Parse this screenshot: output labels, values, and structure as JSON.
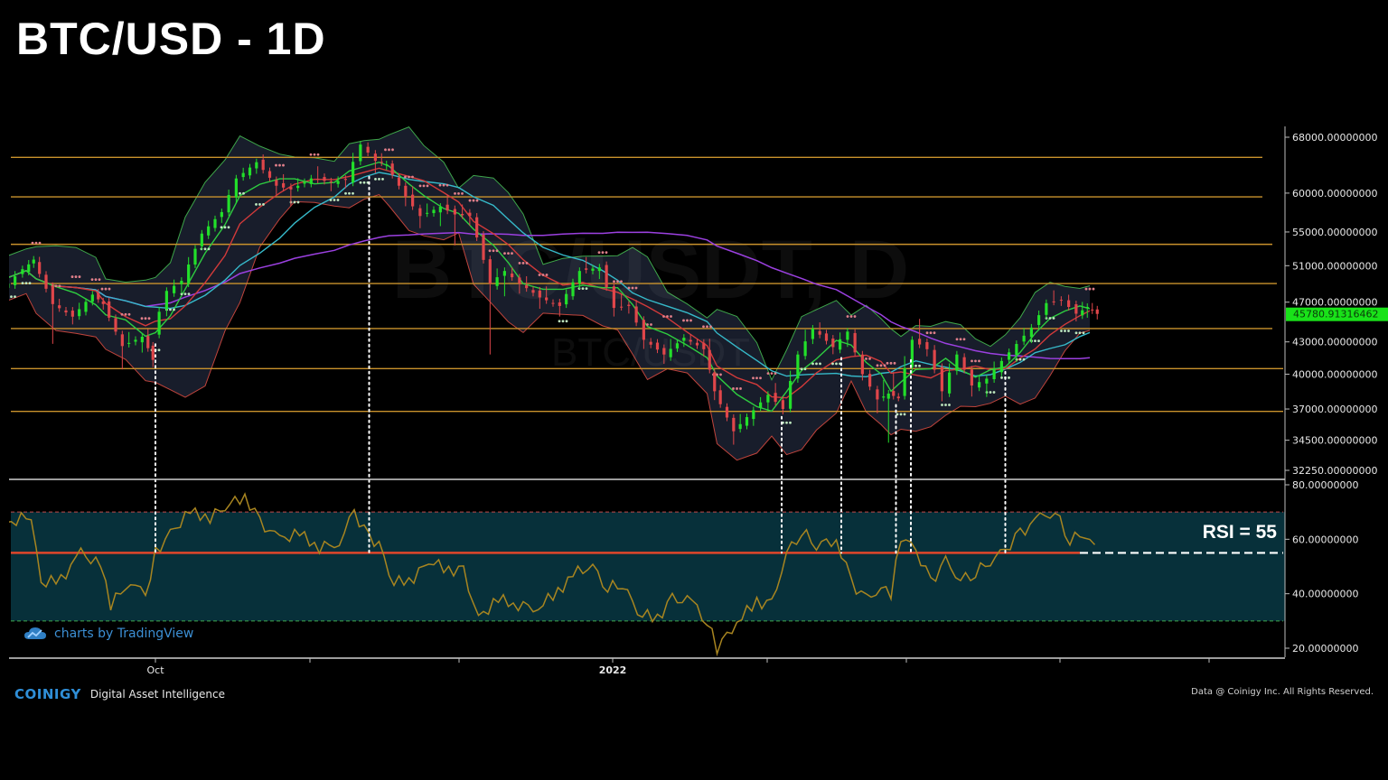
{
  "header": {
    "title": "BTC/USD - 1D"
  },
  "watermark": {
    "line1": "BTC/USDT, D",
    "line2": "BTC/USDT"
  },
  "footer": {
    "brand": "COINIGY",
    "tagline": "Digital Asset Intelligence",
    "copyright": "Data @ Coinigy Inc.  All Rights Reserved.",
    "tradingview": "charts by TradingView"
  },
  "colors": {
    "background": "#000000",
    "bull": "#22e02a",
    "bear": "#e0464a",
    "level": "#c9922c",
    "bb_fill": "#1c2233",
    "bb_upper": "#3ea64a",
    "bb_lower": "#c0443c",
    "ma_fast": "#2ecc40",
    "ma_mid": "#36b9c9",
    "ma_slow": "#9b40e0",
    "ema": "#d23a3a",
    "sar_above": "#e07f8a",
    "sar_below": "#bfe8bf",
    "rsi_line": "#a88520",
    "rsi_band": "#07303a",
    "rsi_mid": "#e0462a",
    "price_tag": "#19e219"
  },
  "chart_data": {
    "type": "candlestick",
    "title": "BTC/USD - 1D",
    "x_labels": [
      "Oct",
      "2022"
    ],
    "price_axis": {
      "ticks": [
        "68000.00000000",
        "60000.00000000",
        "55000.00000000",
        "51000.00000000",
        "47000.00000000",
        "43000.00000000",
        "40000.00000000",
        "37000.00000000",
        "34500.00000000",
        "32250.00000000"
      ],
      "range": [
        31500,
        69500
      ],
      "scale": "log"
    },
    "last_price": "45780.91316462",
    "horizontal_levels": [
      65000,
      59500,
      53500,
      49000,
      44300,
      40500,
      36800
    ],
    "vertical_markers": [
      "2021-10-01",
      "2021-11-13",
      "2022-02-04",
      "2022-02-16",
      "2022-02-27",
      "2022-03-02",
      "2022-03-21"
    ],
    "series": [
      {
        "date": "2021-08-29",
        "open": 47800,
        "high": 49500,
        "low": 47600,
        "close": 49000
      },
      {
        "date": "2021-09-02",
        "open": 49000,
        "high": 51000,
        "low": 48800,
        "close": 50600
      },
      {
        "date": "2021-09-05",
        "open": 50600,
        "high": 52000,
        "low": 50300,
        "close": 51700
      },
      {
        "date": "2021-09-07",
        "open": 51700,
        "high": 52100,
        "low": 43000,
        "close": 46800
      },
      {
        "date": "2021-09-11",
        "open": 46800,
        "high": 47300,
        "low": 44900,
        "close": 45500
      },
      {
        "date": "2021-09-15",
        "open": 45500,
        "high": 48300,
        "low": 45300,
        "close": 47800
      },
      {
        "date": "2021-09-19",
        "open": 47800,
        "high": 48000,
        "low": 46400,
        "close": 46800
      },
      {
        "date": "2021-09-21",
        "open": 46800,
        "high": 47000,
        "low": 40600,
        "close": 42600
      },
      {
        "date": "2021-09-25",
        "open": 42600,
        "high": 44400,
        "low": 41800,
        "close": 43500
      },
      {
        "date": "2021-09-29",
        "open": 43500,
        "high": 44000,
        "low": 40800,
        "close": 41300
      },
      {
        "date": "2021-10-01",
        "open": 43800,
        "high": 48500,
        "low": 43300,
        "close": 48200
      },
      {
        "date": "2021-10-04",
        "open": 48200,
        "high": 49800,
        "low": 47400,
        "close": 49300
      },
      {
        "date": "2021-10-07",
        "open": 49300,
        "high": 55500,
        "low": 49100,
        "close": 54800
      },
      {
        "date": "2021-10-11",
        "open": 54800,
        "high": 58000,
        "low": 54300,
        "close": 57500
      },
      {
        "date": "2021-10-15",
        "open": 57500,
        "high": 62500,
        "low": 57000,
        "close": 62000
      },
      {
        "date": "2021-10-18",
        "open": 62000,
        "high": 64800,
        "low": 61500,
        "close": 64300
      },
      {
        "date": "2021-10-22",
        "open": 64300,
        "high": 64800,
        "low": 60000,
        "close": 61000
      },
      {
        "date": "2021-10-26",
        "open": 61000,
        "high": 62000,
        "low": 58500,
        "close": 60500
      },
      {
        "date": "2021-10-29",
        "open": 60500,
        "high": 62800,
        "low": 60300,
        "close": 62000
      },
      {
        "date": "2021-11-02",
        "open": 62000,
        "high": 63500,
        "low": 60500,
        "close": 61500
      },
      {
        "date": "2021-11-06",
        "open": 61500,
        "high": 62200,
        "low": 60600,
        "close": 61800
      },
      {
        "date": "2021-11-09",
        "open": 61800,
        "high": 68000,
        "low": 61500,
        "close": 66900
      },
      {
        "date": "2021-11-12",
        "open": 66900,
        "high": 67300,
        "low": 63000,
        "close": 64500
      },
      {
        "date": "2021-11-15",
        "open": 64500,
        "high": 65500,
        "low": 63500,
        "close": 64000
      },
      {
        "date": "2021-11-17",
        "open": 64000,
        "high": 64200,
        "low": 58500,
        "close": 59500
      },
      {
        "date": "2021-11-21",
        "open": 59500,
        "high": 60400,
        "low": 55700,
        "close": 57000
      },
      {
        "date": "2021-11-24",
        "open": 57000,
        "high": 59200,
        "low": 55500,
        "close": 58200
      },
      {
        "date": "2021-11-28",
        "open": 58200,
        "high": 59300,
        "low": 53600,
        "close": 57200
      },
      {
        "date": "2021-12-01",
        "open": 57200,
        "high": 58200,
        "low": 56000,
        "close": 57000
      },
      {
        "date": "2021-12-04",
        "open": 57000,
        "high": 57300,
        "low": 42000,
        "close": 49000
      },
      {
        "date": "2021-12-08",
        "open": 49000,
        "high": 51200,
        "low": 47000,
        "close": 50400
      },
      {
        "date": "2021-12-11",
        "open": 50400,
        "high": 50900,
        "low": 48100,
        "close": 49000
      },
      {
        "date": "2021-12-14",
        "open": 49000,
        "high": 49800,
        "low": 46500,
        "close": 47500
      },
      {
        "date": "2021-12-18",
        "open": 47500,
        "high": 48500,
        "low": 45700,
        "close": 46600
      },
      {
        "date": "2021-12-22",
        "open": 46600,
        "high": 50700,
        "low": 46200,
        "close": 50400
      },
      {
        "date": "2021-12-26",
        "open": 50400,
        "high": 51900,
        "low": 49700,
        "close": 50800
      },
      {
        "date": "2021-12-30",
        "open": 50800,
        "high": 51000,
        "low": 45700,
        "close": 46400
      },
      {
        "date": "2022-01-02",
        "open": 46400,
        "high": 47800,
        "low": 45800,
        "close": 46600
      },
      {
        "date": "2022-01-05",
        "open": 46600,
        "high": 47100,
        "low": 42500,
        "close": 43200
      },
      {
        "date": "2022-01-08",
        "open": 43200,
        "high": 43400,
        "low": 41100,
        "close": 41800
      },
      {
        "date": "2022-01-12",
        "open": 41800,
        "high": 44200,
        "low": 41400,
        "close": 43400
      },
      {
        "date": "2022-01-16",
        "open": 43400,
        "high": 43800,
        "low": 41800,
        "close": 42300
      },
      {
        "date": "2022-01-20",
        "open": 42300,
        "high": 43200,
        "low": 37900,
        "close": 38500
      },
      {
        "date": "2022-01-22",
        "open": 38500,
        "high": 38800,
        "low": 34300,
        "close": 35200
      },
      {
        "date": "2022-01-26",
        "open": 35200,
        "high": 37600,
        "low": 34800,
        "close": 36900
      },
      {
        "date": "2022-01-30",
        "open": 36900,
        "high": 38500,
        "low": 36300,
        "close": 38200
      },
      {
        "date": "2022-02-02",
        "open": 38200,
        "high": 38900,
        "low": 36700,
        "close": 37000
      },
      {
        "date": "2022-02-05",
        "open": 37000,
        "high": 42600,
        "low": 36800,
        "close": 41800
      },
      {
        "date": "2022-02-08",
        "open": 41800,
        "high": 45300,
        "low": 41500,
        "close": 44300
      },
      {
        "date": "2022-02-11",
        "open": 44300,
        "high": 45000,
        "low": 42000,
        "close": 42500
      },
      {
        "date": "2022-02-15",
        "open": 42500,
        "high": 44500,
        "low": 42000,
        "close": 44000
      },
      {
        "date": "2022-02-18",
        "open": 44000,
        "high": 44200,
        "low": 39600,
        "close": 40000
      },
      {
        "date": "2022-02-21",
        "open": 40000,
        "high": 40200,
        "low": 36800,
        "close": 37800
      },
      {
        "date": "2022-02-24",
        "open": 37800,
        "high": 39600,
        "low": 34400,
        "close": 38300
      },
      {
        "date": "2022-02-26",
        "open": 38300,
        "high": 39800,
        "low": 37800,
        "close": 37900
      },
      {
        "date": "2022-02-28",
        "open": 37900,
        "high": 44200,
        "low": 37500,
        "close": 43200
      },
      {
        "date": "2022-03-03",
        "open": 43200,
        "high": 45000,
        "low": 41800,
        "close": 42300
      },
      {
        "date": "2022-03-06",
        "open": 42300,
        "high": 42600,
        "low": 37800,
        "close": 38500
      },
      {
        "date": "2022-03-09",
        "open": 38500,
        "high": 42500,
        "low": 38300,
        "close": 41800
      },
      {
        "date": "2022-03-12",
        "open": 41800,
        "high": 42000,
        "low": 38200,
        "close": 39000
      },
      {
        "date": "2022-03-15",
        "open": 39000,
        "high": 40000,
        "low": 38000,
        "close": 39600
      },
      {
        "date": "2022-03-18",
        "open": 39600,
        "high": 41800,
        "low": 39400,
        "close": 41200
      },
      {
        "date": "2022-03-21",
        "open": 41200,
        "high": 43000,
        "low": 40700,
        "close": 42800
      },
      {
        "date": "2022-03-24",
        "open": 42800,
        "high": 45000,
        "low": 42400,
        "close": 44400
      },
      {
        "date": "2022-03-27",
        "open": 44400,
        "high": 47200,
        "low": 44200,
        "close": 46900
      },
      {
        "date": "2022-03-30",
        "open": 46900,
        "high": 48200,
        "low": 46500,
        "close": 47200
      },
      {
        "date": "2022-04-02",
        "open": 47200,
        "high": 47600,
        "low": 45200,
        "close": 45800
      },
      {
        "date": "2022-04-05",
        "open": 45800,
        "high": 47200,
        "low": 45000,
        "close": 46500
      },
      {
        "date": "2022-04-07",
        "open": 46500,
        "high": 47000,
        "low": 45400,
        "close": 45780
      }
    ],
    "indicators": {
      "rsi": {
        "axis_ticks": [
          "80.00000000",
          "60.00000000",
          "40.00000000",
          "20.00000000"
        ],
        "range": [
          18,
          82
        ],
        "upper_band": 70,
        "lower_band": 30,
        "midline": 55,
        "annotation": "RSI = 55",
        "values": [
          [
            "2021-08-29",
            62
          ],
          [
            "2021-09-03",
            67
          ],
          [
            "2021-09-06",
            69
          ],
          [
            "2021-09-08",
            44
          ],
          [
            "2021-09-12",
            45
          ],
          [
            "2021-09-16",
            55
          ],
          [
            "2021-09-20",
            50
          ],
          [
            "2021-09-22",
            36
          ],
          [
            "2021-09-26",
            45
          ],
          [
            "2021-09-29",
            39
          ],
          [
            "2021-10-01",
            55
          ],
          [
            "2021-10-04",
            62
          ],
          [
            "2021-10-08",
            70
          ],
          [
            "2021-10-12",
            68
          ],
          [
            "2021-10-15",
            72
          ],
          [
            "2021-10-19",
            76
          ],
          [
            "2021-10-22",
            66
          ],
          [
            "2021-10-26",
            60
          ],
          [
            "2021-10-30",
            62
          ],
          [
            "2021-11-03",
            57
          ],
          [
            "2021-11-07",
            59
          ],
          [
            "2021-11-10",
            70
          ],
          [
            "2021-11-13",
            60
          ],
          [
            "2021-11-15",
            58
          ],
          [
            "2021-11-18",
            44
          ],
          [
            "2021-11-22",
            46
          ],
          [
            "2021-11-25",
            52
          ],
          [
            "2021-11-29",
            49
          ],
          [
            "2021-12-02",
            48
          ],
          [
            "2021-12-05",
            31
          ],
          [
            "2021-12-09",
            38
          ],
          [
            "2021-12-13",
            36
          ],
          [
            "2021-12-17",
            35
          ],
          [
            "2021-12-21",
            41
          ],
          [
            "2021-12-25",
            48
          ],
          [
            "2021-12-28",
            50
          ],
          [
            "2021-12-31",
            42
          ],
          [
            "2022-01-03",
            44
          ],
          [
            "2022-01-06",
            33
          ],
          [
            "2022-01-10",
            31
          ],
          [
            "2022-01-13",
            38
          ],
          [
            "2022-01-17",
            37
          ],
          [
            "2022-01-20",
            30
          ],
          [
            "2022-01-22",
            20
          ],
          [
            "2022-01-26",
            30
          ],
          [
            "2022-01-30",
            37
          ],
          [
            "2022-02-02",
            36
          ],
          [
            "2022-02-05",
            55
          ],
          [
            "2022-02-08",
            63
          ],
          [
            "2022-02-11",
            58
          ],
          [
            "2022-02-15",
            60
          ],
          [
            "2022-02-18",
            44
          ],
          [
            "2022-02-21",
            38
          ],
          [
            "2022-02-24",
            42
          ],
          [
            "2022-02-26",
            40
          ],
          [
            "2022-02-28",
            61
          ],
          [
            "2022-03-03",
            56
          ],
          [
            "2022-03-06",
            44
          ],
          [
            "2022-03-09",
            52
          ],
          [
            "2022-03-12",
            45
          ],
          [
            "2022-03-15",
            48
          ],
          [
            "2022-03-18",
            52
          ],
          [
            "2022-03-21",
            56
          ],
          [
            "2022-03-24",
            62
          ],
          [
            "2022-03-28",
            68
          ],
          [
            "2022-03-31",
            70
          ],
          [
            "2022-04-03",
            60
          ],
          [
            "2022-04-06",
            62
          ],
          [
            "2022-04-08",
            58
          ]
        ]
      }
    }
  }
}
